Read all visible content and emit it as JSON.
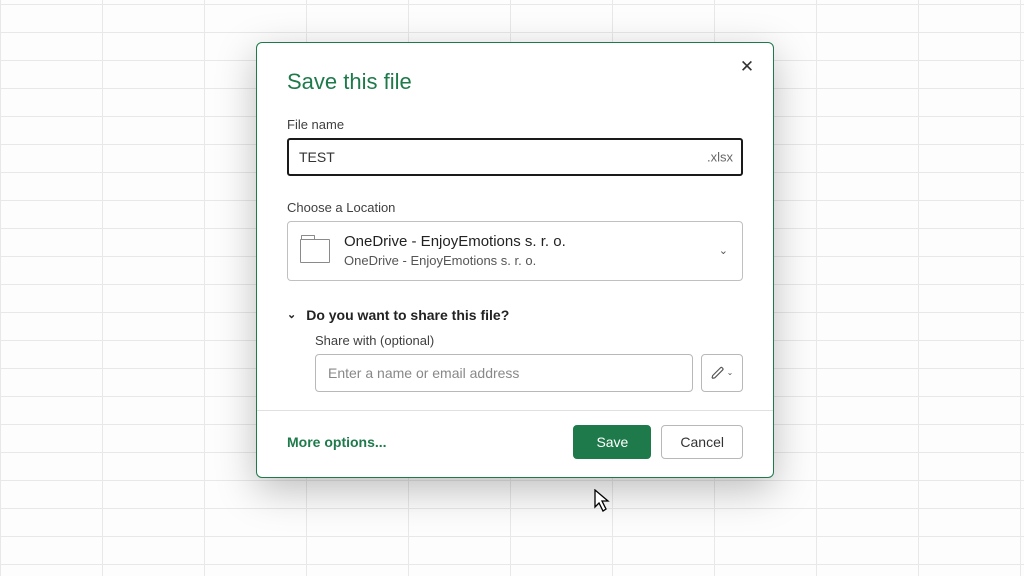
{
  "dialog": {
    "title": "Save this file",
    "close_glyph": "✕",
    "file_name_label": "File name",
    "file_name_value": "TEST",
    "file_extension": ".xlsx",
    "location_label": "Choose a Location",
    "location_title": "OneDrive - EnjoyEmotions s. r. o.",
    "location_sub": "OneDrive - EnjoyEmotions s. r. o.",
    "location_chevron": "⌄",
    "share_header": "Do you want to share this file?",
    "share_caret": "⌄",
    "share_label": "Share with (optional)",
    "share_placeholder": "Enter a name or email address",
    "perm_caret": "⌄",
    "more_options": "More options...",
    "save_label": "Save",
    "cancel_label": "Cancel"
  },
  "colors": {
    "accent": "#1e7a4b"
  }
}
